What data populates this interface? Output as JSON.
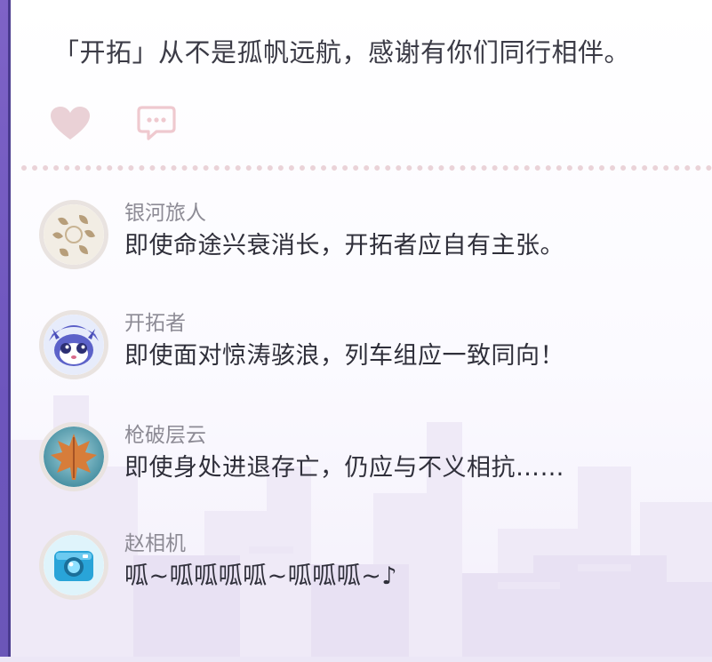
{
  "post": {
    "text": "「开拓」从不是孤帆远航，感谢有你们同行相伴。"
  },
  "actions": {
    "like_icon": "heart-icon",
    "comment_icon": "comment-bubble-icon"
  },
  "comments": [
    {
      "name": "银河旅人",
      "text": "即使命途兴衰消长，开拓者应自有主张。",
      "avatar_icon": "leaf-emblem-avatar"
    },
    {
      "name": "开拓者",
      "text": "即使面对惊涛骇浪，列车组应一致同向！",
      "avatar_icon": "pompom-avatar"
    },
    {
      "name": "枪破层云",
      "text": "即使身处进退存亡，仍应与不义相抗……",
      "avatar_icon": "maple-leaf-avatar"
    },
    {
      "name": "赵相机",
      "text": "呱~呱呱呱呱~呱呱呱~♪",
      "avatar_icon": "camera-avatar"
    }
  ],
  "colors": {
    "rail": "#6d55bd",
    "heart": "#ead1d6",
    "divider": "#ead3d8"
  }
}
